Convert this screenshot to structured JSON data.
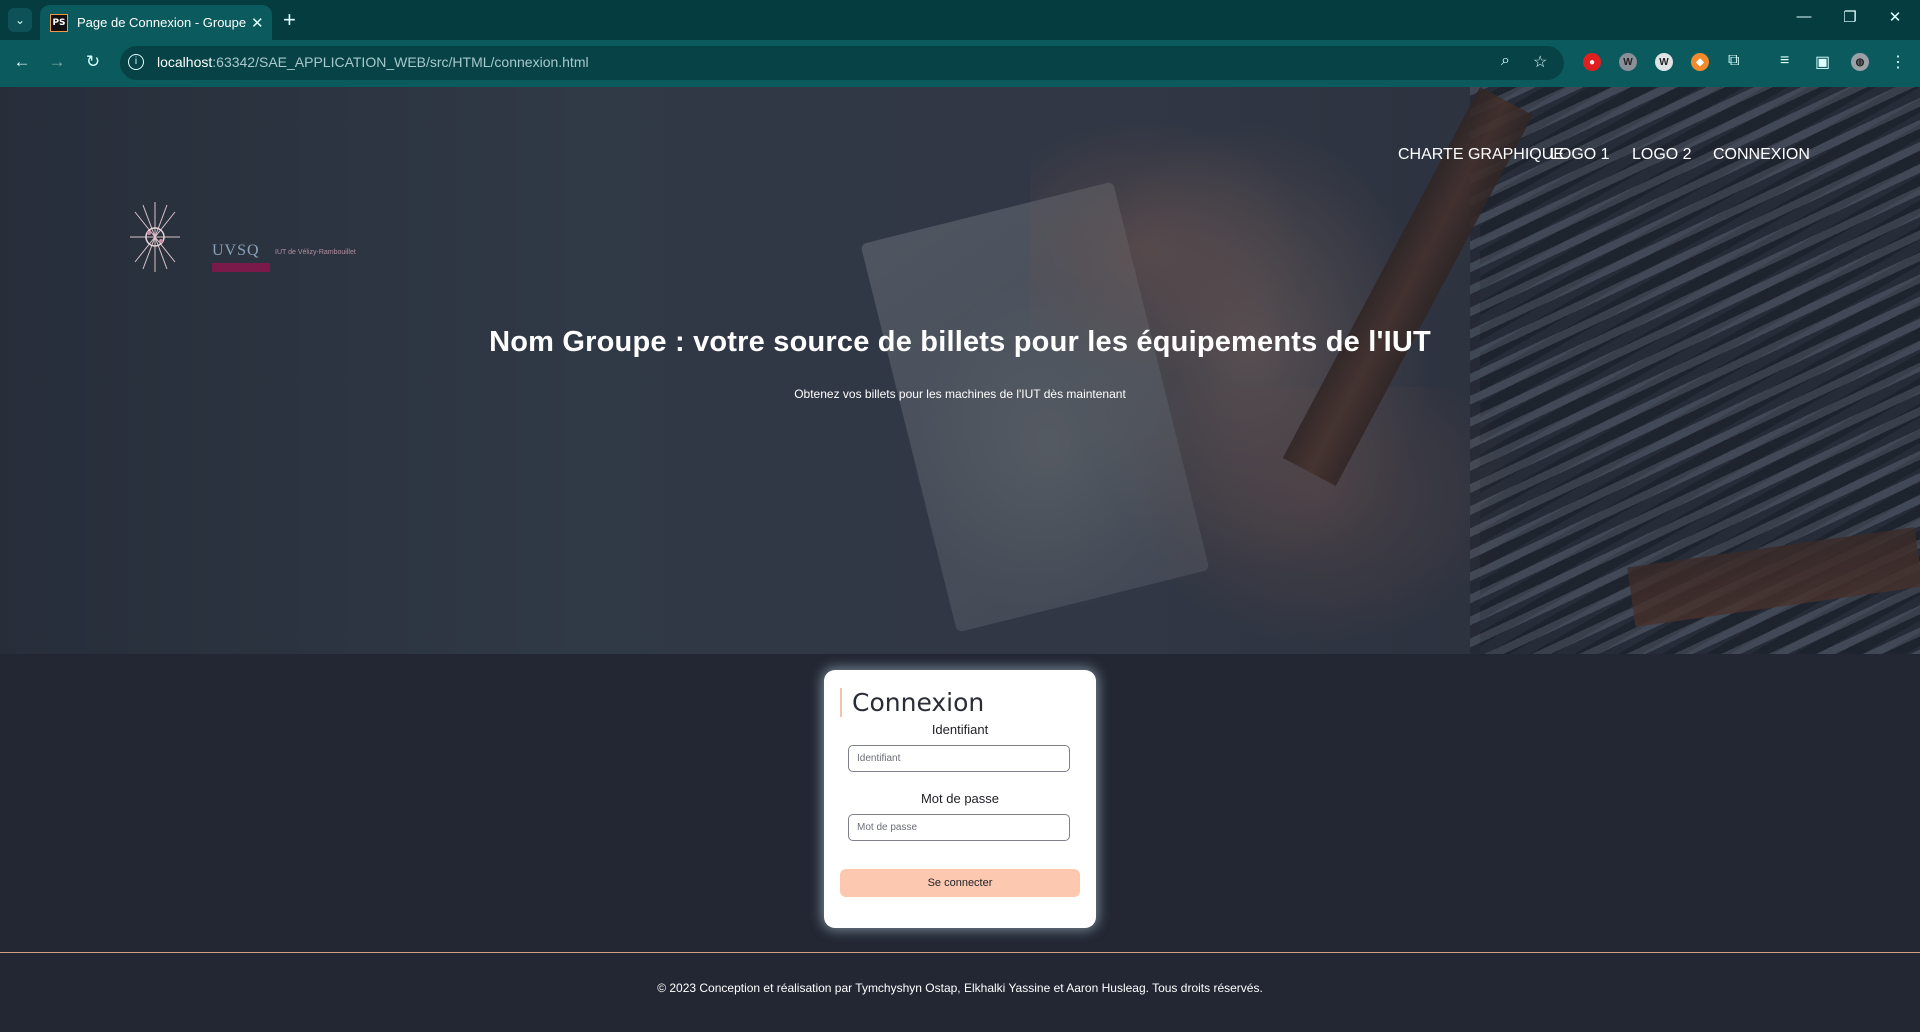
{
  "browser": {
    "tab_title": "Page de Connexion - Groupe C",
    "tab_favicon_text": "PS",
    "url_host": "localhost",
    "url_rest": ":63342/SAE_APPLICATION_WEB/src/HTML/connexion.html"
  },
  "header": {
    "logo_text": "UVSQ",
    "logo_sub": "IUT de Vélizy-Rambouillet",
    "logo_sub2": "",
    "nav": [
      "CHARTE GRAPHIQUE",
      "LOGO 1",
      "LOGO 2",
      "CONNEXION"
    ]
  },
  "hero": {
    "title": "Nom Groupe : votre source de billets pour les équipements de l'IUT",
    "subtitle": "Obtenez vos billets pour les machines de l'IUT dès maintenant"
  },
  "login": {
    "title": "Connexion",
    "id_label": "Identifiant",
    "id_placeholder": "Identifiant",
    "password_label": "Mot de passe",
    "password_placeholder": "Mot de passe",
    "submit_label": "Se connecter",
    "accent_color": "#fcc8b0"
  },
  "footer": {
    "text": "© 2023 Conception et réalisation par Tymchyshyn Ostap, Elkhalki Yassine et Aaron Husleag. Tous droits réservés."
  }
}
